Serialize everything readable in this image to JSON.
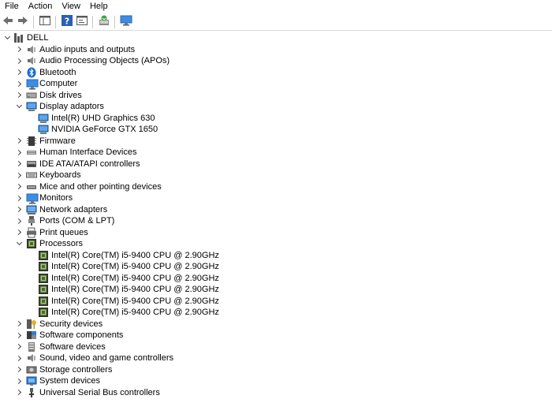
{
  "menu": [
    "File",
    "Action",
    "View",
    "Help"
  ],
  "toolbar": [
    {
      "icon": "back-arrow-icon"
    },
    {
      "icon": "forward-arrow-icon"
    },
    {
      "sep": true
    },
    {
      "icon": "show-hide-console-tree-icon"
    },
    {
      "sep": true
    },
    {
      "icon": "help-icon"
    },
    {
      "icon": "properties-icon"
    },
    {
      "sep": true
    },
    {
      "icon": "scan-hardware-changes-icon"
    },
    {
      "sep": true
    },
    {
      "icon": "monitor-icon"
    }
  ],
  "tree": [
    {
      "label": "DELL",
      "level": 0,
      "expanded": true,
      "icon": "computer-tree-icon"
    },
    {
      "label": "Audio inputs and outputs",
      "level": 1,
      "expanded": false,
      "icon": "speaker-icon"
    },
    {
      "label": "Audio Processing Objects (APOs)",
      "level": 1,
      "expanded": false,
      "icon": "speaker-icon"
    },
    {
      "label": "Bluetooth",
      "level": 1,
      "expanded": false,
      "icon": "bluetooth-icon"
    },
    {
      "label": "Computer",
      "level": 1,
      "expanded": false,
      "icon": "monitor-icon"
    },
    {
      "label": "Disk drives",
      "level": 1,
      "expanded": false,
      "icon": "disk-drive-icon"
    },
    {
      "label": "Display adaptors",
      "level": 1,
      "expanded": true,
      "icon": "display-adapter-icon"
    },
    {
      "label": "Intel(R) UHD Graphics 630",
      "level": 2,
      "icon": "display-adapter-icon"
    },
    {
      "label": "NVIDIA GeForce GTX 1650",
      "level": 2,
      "icon": "display-adapter-icon"
    },
    {
      "label": "Firmware",
      "level": 1,
      "expanded": false,
      "icon": "firmware-icon"
    },
    {
      "label": "Human Interface Devices",
      "level": 1,
      "expanded": false,
      "icon": "hid-icon"
    },
    {
      "label": "IDE ATA/ATAPI controllers",
      "level": 1,
      "expanded": false,
      "icon": "ide-controller-icon"
    },
    {
      "label": "Keyboards",
      "level": 1,
      "expanded": false,
      "icon": "keyboard-icon"
    },
    {
      "label": "Mice and other pointing devices",
      "level": 1,
      "expanded": false,
      "icon": "mouse-icon"
    },
    {
      "label": "Monitors",
      "level": 1,
      "expanded": false,
      "icon": "monitor-icon"
    },
    {
      "label": "Network adapters",
      "level": 1,
      "expanded": false,
      "icon": "network-adapter-icon"
    },
    {
      "label": "Ports (COM & LPT)",
      "level": 1,
      "expanded": false,
      "icon": "port-icon"
    },
    {
      "label": "Print queues",
      "level": 1,
      "expanded": false,
      "icon": "printer-icon"
    },
    {
      "label": "Processors",
      "level": 1,
      "expanded": true,
      "icon": "processor-icon"
    },
    {
      "label": "Intel(R) Core(TM) i5-9400 CPU @ 2.90GHz",
      "level": 2,
      "icon": "processor-icon"
    },
    {
      "label": "Intel(R) Core(TM) i5-9400 CPU @ 2.90GHz",
      "level": 2,
      "icon": "processor-icon"
    },
    {
      "label": "Intel(R) Core(TM) i5-9400 CPU @ 2.90GHz",
      "level": 2,
      "icon": "processor-icon"
    },
    {
      "label": "Intel(R) Core(TM) i5-9400 CPU @ 2.90GHz",
      "level": 2,
      "icon": "processor-icon"
    },
    {
      "label": "Intel(R) Core(TM) i5-9400 CPU @ 2.90GHz",
      "level": 2,
      "icon": "processor-icon"
    },
    {
      "label": "Intel(R) Core(TM) i5-9400 CPU @ 2.90GHz",
      "level": 2,
      "icon": "processor-icon"
    },
    {
      "label": "Security devices",
      "level": 1,
      "expanded": false,
      "icon": "security-key-icon"
    },
    {
      "label": "Software components",
      "level": 1,
      "expanded": false,
      "icon": "software-component-icon"
    },
    {
      "label": "Software devices",
      "level": 1,
      "expanded": false,
      "icon": "software-device-icon"
    },
    {
      "label": "Sound, video and game controllers",
      "level": 1,
      "expanded": false,
      "icon": "speaker-icon"
    },
    {
      "label": "Storage controllers",
      "level": 1,
      "expanded": false,
      "icon": "storage-controller-icon"
    },
    {
      "label": "System devices",
      "level": 1,
      "expanded": false,
      "icon": "system-devices-icon"
    },
    {
      "label": "Universal Serial Bus controllers",
      "level": 1,
      "expanded": false,
      "icon": "usb-icon"
    }
  ]
}
